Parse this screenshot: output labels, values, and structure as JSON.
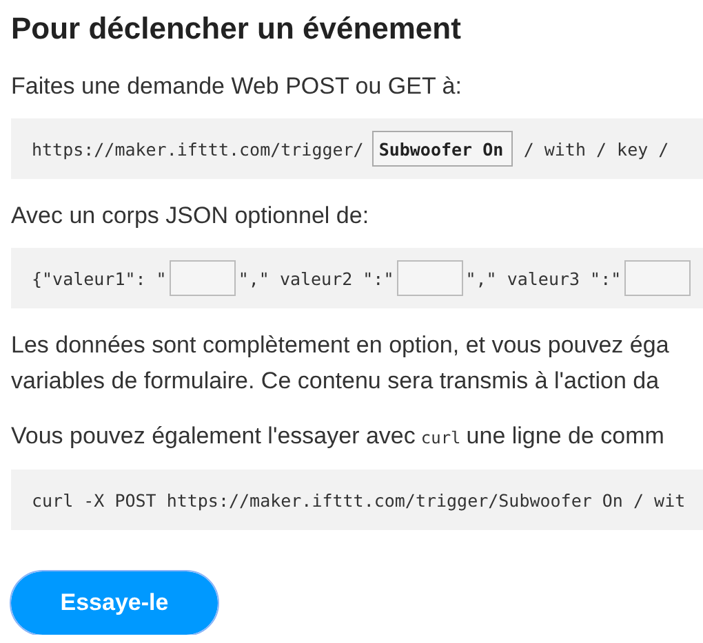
{
  "heading": "Pour déclencher un événement",
  "intro": "Faites une demande Web POST ou GET à:",
  "url_block": {
    "prefix": "https://maker.ifttt.com/trigger/",
    "event_field": {
      "value": "Subwoofer On"
    },
    "suffix": "/ with / key /"
  },
  "body_intro": "Avec un corps JSON optionnel de:",
  "json_block": [
    {
      "before": "{\"valeur1\": \""
    },
    {
      "before": "\",\" valeur2 \":\""
    },
    {
      "before": "\",\" valeur3 \":\""
    }
  ],
  "note_lines": [
    "Les données sont complètement en option, et vous pouvez éga",
    "variables de formulaire. Ce contenu sera transmis à l'action da"
  ],
  "curl_sentence": {
    "before": "Vous pouvez également l'essayer avec",
    "code": "curl",
    "after": "une ligne de comm"
  },
  "curl_block": "curl -X POST https://maker.ifttt.com/trigger/Subwoofer On / wit",
  "button": {
    "label": "Essaye-le",
    "focused": true
  }
}
